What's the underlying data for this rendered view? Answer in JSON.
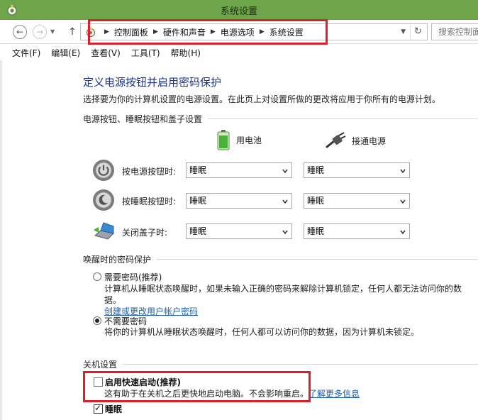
{
  "window": {
    "title": "系统设置"
  },
  "nav": {
    "breadcrumbs": [
      "控制面板",
      "硬件和声音",
      "电源选项",
      "系统设置"
    ],
    "search_placeholder": "搜索控制面板"
  },
  "menu": [
    "文件(F)",
    "编辑(E)",
    "查看(V)",
    "工具(T)",
    "帮助(H)"
  ],
  "main": {
    "title": "定义电源按钮并启用密码保护",
    "description": "选择要为你的计算机设置的电源设置。在此页上对设置所做的更改将应用于你所有的电源计划。",
    "power_section": {
      "header": "电源按钮、睡眠按钮和盖子设置",
      "columns": [
        "用电池",
        "接通电源"
      ],
      "rows": [
        {
          "label": "按电源按钮时:",
          "battery": "睡眠",
          "plugged": "睡眠",
          "icon": "power-button-icon"
        },
        {
          "label": "按睡眠按钮时:",
          "battery": "睡眠",
          "plugged": "睡眠",
          "icon": "sleep-button-icon"
        },
        {
          "label": "关闭盖子时:",
          "battery": "睡眠",
          "plugged": "睡眠",
          "icon": "laptop-lid-icon"
        }
      ]
    },
    "password_section": {
      "header": "唤醒时的密码保护",
      "require": {
        "label": "需要密码(推荐)",
        "desc": "计算机从睡眠状态唤醒时，如果未输入正确的密码来解除计算机锁定，任何人都无法访问你的数",
        "desc2": "据。",
        "link": "创建或更改用户帐户密码",
        "checked": false
      },
      "no_require": {
        "label": "不需要密码",
        "desc": "将你的计算机从睡眠状态唤醒时，任何人都可以访问你的数据，因为计算机未锁定。",
        "checked": true
      }
    },
    "shutdown_section": {
      "header": "关机设置",
      "fast_startup": {
        "label": "启用快速启动(推荐)",
        "desc": "这有助于在关机之后更快地启动电脑。不会影响重启。",
        "link": "了解更多信息",
        "checked": false
      },
      "sleep": {
        "label": "睡眠",
        "checked": true
      }
    }
  },
  "colors": {
    "titlebar": "#6ea54a",
    "highlight": "#d9212c",
    "title_text": "#1e3287",
    "link": "#1a5fb4"
  }
}
